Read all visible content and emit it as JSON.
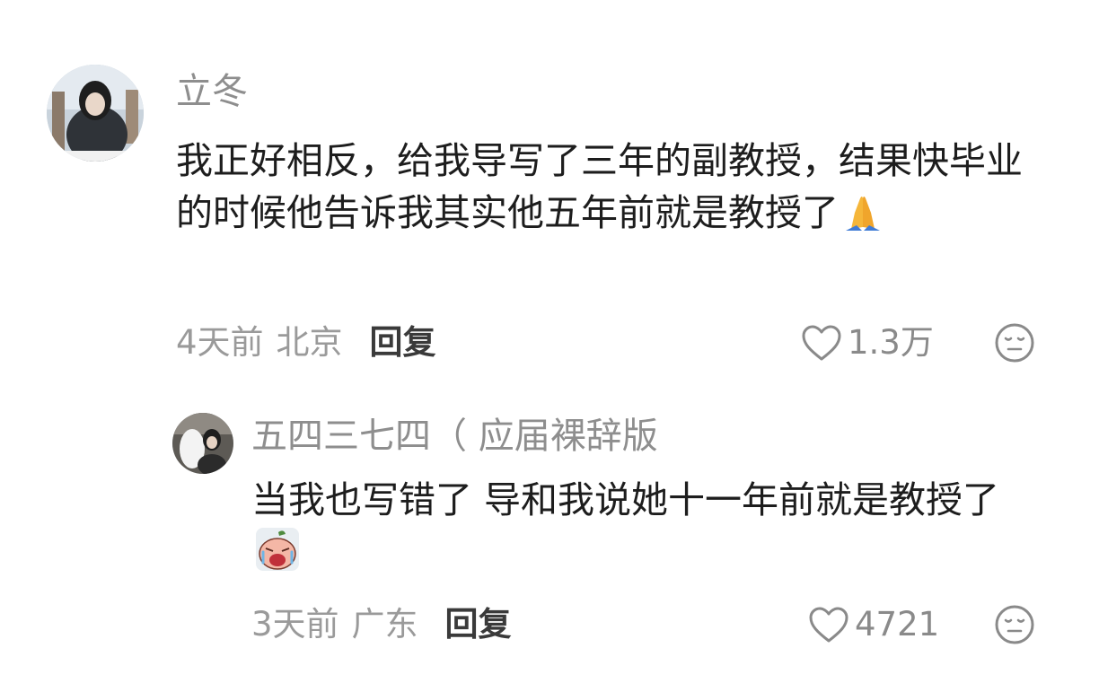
{
  "comments": [
    {
      "username": "立冬",
      "content": "我正好相反，给我导写了三年的副教授，结果快毕业的时候他告诉我其实他五年前就是教授了",
      "emoji": "folded-hands-emoji",
      "time": "4天前",
      "location": "北京",
      "reply_label": "回复",
      "likes": "1.3万"
    },
    {
      "username": "五四三七四（ 应届裸辞版",
      "content": "当我也写错了 导和我说她十一年前就是教授了",
      "emoji": "crying-face-sticker",
      "time": "3天前",
      "location": "广东",
      "reply_label": "回复",
      "likes": "4721"
    }
  ],
  "colors": {
    "username": "#8e8e8e",
    "content": "#1d1d1d",
    "meta": "#9a9a9a",
    "reply": "#3a3a3a",
    "icon": "#8a8a8a"
  }
}
